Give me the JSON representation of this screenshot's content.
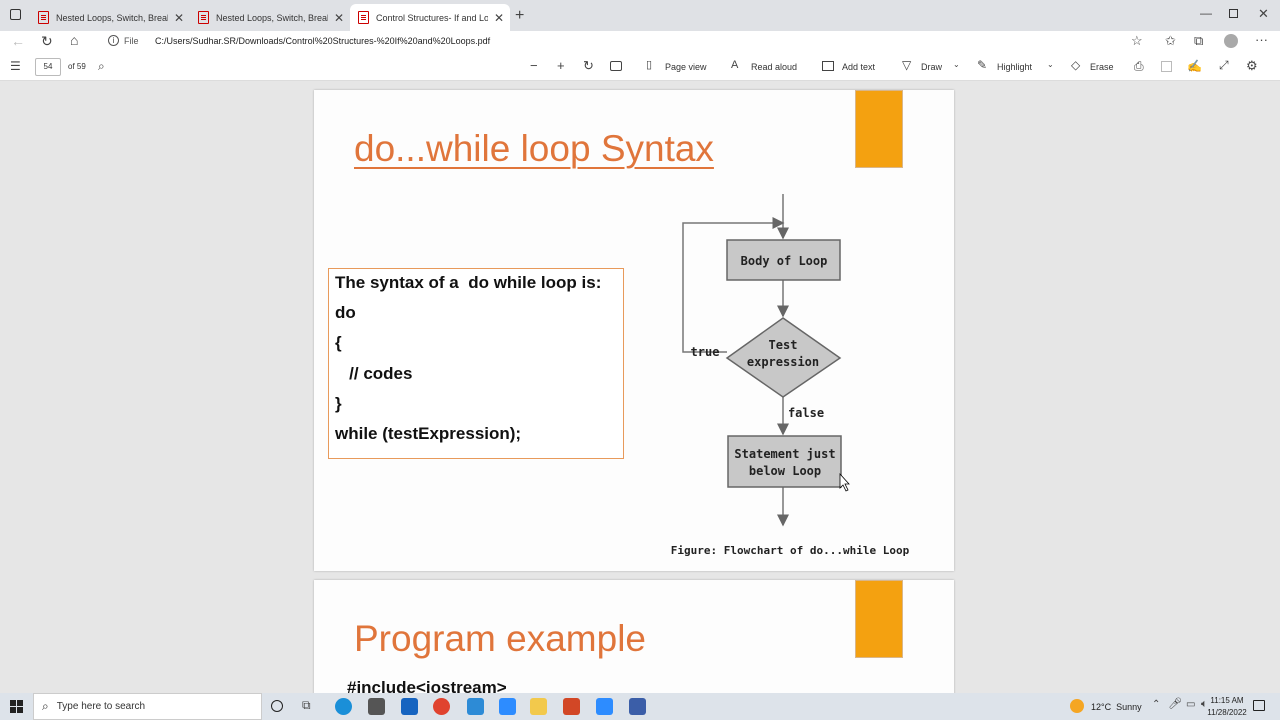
{
  "browser": {
    "tabs": [
      {
        "title": "Nested Loops, Switch, Break, Co",
        "active": false
      },
      {
        "title": "Nested Loops, Switch, Break, Co",
        "active": false
      },
      {
        "title": "Control Structures- If and Loops",
        "active": true
      }
    ],
    "address": {
      "scheme_label": "File",
      "url": "C:/Users/Sudhar.SR/Downloads/Control%20Structures-%20If%20and%20Loops.pdf"
    }
  },
  "pdf_toolbar": {
    "page_number": "54",
    "page_total": "of 59",
    "page_view": "Page view",
    "read_aloud": "Read aloud",
    "add_text": "Add text",
    "draw": "Draw",
    "highlight": "Highlight",
    "erase": "Erase"
  },
  "slide1": {
    "title": "do...while loop Syntax",
    "code_lines": [
      "The syntax of a  do while loop is:",
      "do",
      "{",
      "   // codes",
      "}",
      "while (testExpression);"
    ],
    "flowchart": {
      "body": "Body of Loop",
      "test_line1": "Test",
      "test_line2": "expression",
      "true_label": "true",
      "false_label": "false",
      "stmt_line1": "Statement just",
      "stmt_line2": "below Loop",
      "caption": "Figure: Flowchart of do...while Loop"
    }
  },
  "slide2": {
    "title": "Program example",
    "first_line": "#include<iostream>"
  },
  "taskbar": {
    "search_placeholder": "Type here to search",
    "weather": "12°C  Sunny",
    "time": "11:15 AM",
    "date": "11/28/2022"
  },
  "colors": {
    "title_orange": "#e0753b",
    "block_orange": "#f4a110",
    "flow_box_gray": "#c8c8c8"
  }
}
